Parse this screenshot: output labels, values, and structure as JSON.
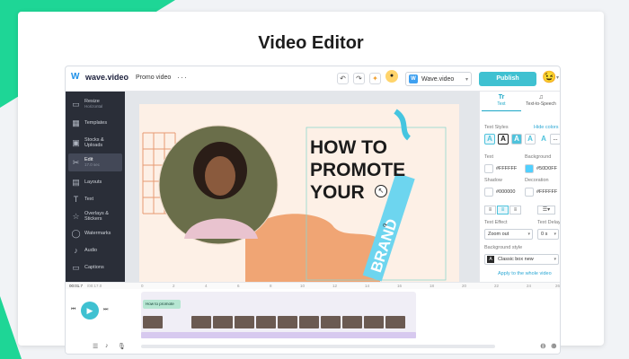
{
  "page": {
    "title": "Video Editor"
  },
  "colors": {
    "accent": "#3fc1d1",
    "brand_green": "#1ed696",
    "sidebar": "#2a2e38",
    "headline": "#1b1b1b"
  },
  "header": {
    "logo_text": "wave.video",
    "project_name": "Promo video",
    "more_icon": "more-icon",
    "undo_icon": "undo-icon",
    "redo_icon": "redo-icon",
    "workspace": "Wave.video",
    "publish": "Publish"
  },
  "sidebar": {
    "items": [
      {
        "label": "Resize",
        "sub": "Horizontal",
        "icon": "resize-icon"
      },
      {
        "label": "Templates",
        "icon": "templates-icon"
      },
      {
        "label": "Stocks & Uploads",
        "icon": "stocks-icon"
      },
      {
        "label": "Edit",
        "sub": "17.0 sec",
        "icon": "edit-icon"
      },
      {
        "label": "Layouts",
        "icon": "layouts-icon"
      },
      {
        "label": "Text",
        "icon": "text-icon"
      },
      {
        "label": "Overlays & Stickers",
        "icon": "overlays-icon"
      },
      {
        "label": "Watermarks",
        "icon": "watermarks-icon"
      },
      {
        "label": "Audio",
        "icon": "audio-icon"
      },
      {
        "label": "Captions",
        "icon": "captions-icon"
      }
    ]
  },
  "canvas": {
    "headline_lines": [
      "HOW TO",
      "PROMOTE",
      "YOUR"
    ],
    "vertical_word": "BRAND"
  },
  "panel": {
    "tabs": [
      "Text",
      "Text-to-Speech"
    ],
    "text_styles_label": "Text Styles",
    "hide_colors": "Hide colors",
    "style_letters": [
      "A",
      "A",
      "A",
      "A",
      "A",
      "..."
    ],
    "text_label": "Text",
    "text_color": "#FFFFFF",
    "background_label": "Background",
    "background_color": "#50D0FF",
    "shadow_label": "Shadow",
    "shadow_color": "#000000",
    "decoration_label": "Decoration",
    "decoration_color": "#FFFFFF",
    "effect_label": "Text Effect",
    "effect_value": "Zoom out",
    "delay_label": "Text Delay",
    "delay_value": "0 s",
    "bgstyle_label": "Background style",
    "bgstyle_value": "Classic box new",
    "apply_all": "Apply to the whole video"
  },
  "timeline": {
    "time": "00:01.7",
    "total": "/00:17.0",
    "ticks": [
      "0",
      "2",
      "4",
      "6",
      "8",
      "10",
      "12",
      "14",
      "16",
      "18",
      "20",
      "22",
      "24",
      "26"
    ],
    "text_track": "How to promote"
  }
}
